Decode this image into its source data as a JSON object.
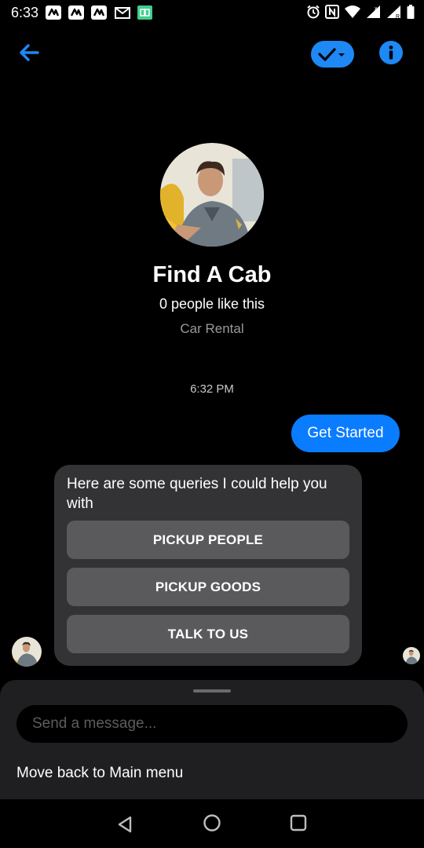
{
  "status_bar": {
    "time": "6:33",
    "notification_icons": [
      "news-icon",
      "news-icon",
      "news-icon",
      "gmail-icon",
      "app-icon"
    ],
    "system_icons": [
      "alarm-icon",
      "nfc-icon",
      "wifi-icon",
      "signal-icon",
      "signal-icon",
      "battery-icon"
    ]
  },
  "header": {
    "back_icon": "back-arrow-icon",
    "filter_icon": "check-dropdown-icon",
    "info_icon": "info-icon",
    "accent_color": "#1e88f5"
  },
  "profile": {
    "name": "Find A Cab",
    "likes": "0 people like this",
    "category": "Car Rental"
  },
  "conversation": {
    "timestamp": "6:32 PM",
    "user_message": "Get Started",
    "bot_message": "Here are some queries I could help you with",
    "quick_replies": [
      {
        "label": "PICKUP PEOPLE"
      },
      {
        "label": "PICKUP GOODS"
      },
      {
        "label": "TALK TO US"
      }
    ]
  },
  "composer": {
    "placeholder": "Send a message...",
    "value": "",
    "menu_link": "Move back to Main menu"
  },
  "nav_bar": {
    "icons": [
      "back-triangle-icon",
      "home-circle-icon",
      "recents-square-icon"
    ]
  }
}
